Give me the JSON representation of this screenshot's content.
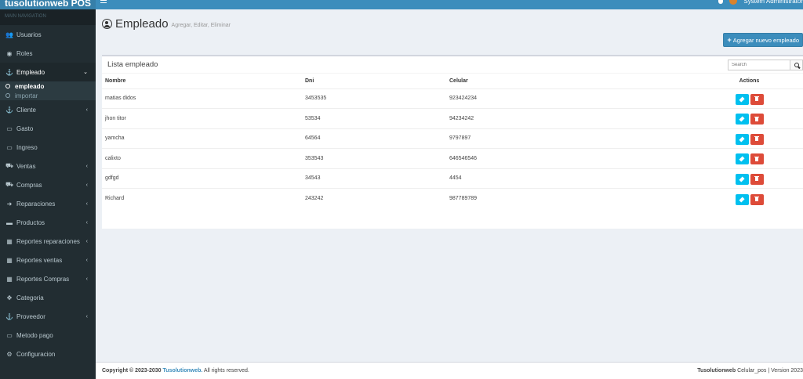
{
  "app": {
    "brand": "tusolutionweb POS",
    "user_name": "System Administrator"
  },
  "sidebar": {
    "header": "MAIN NAVIGATION",
    "items": [
      {
        "label": "Usuarios",
        "icon": "users-icon",
        "chevron": false
      },
      {
        "label": "Roles",
        "icon": "user-circle-icon",
        "chevron": false
      },
      {
        "label": "Empleado",
        "icon": "anchor-icon",
        "chevron": true,
        "active": true
      },
      {
        "label": "Cliente",
        "icon": "anchor-icon",
        "chevron": true
      },
      {
        "label": "Gasto",
        "icon": "money-icon",
        "chevron": false
      },
      {
        "label": "Ingreso",
        "icon": "money-icon",
        "chevron": false
      },
      {
        "label": "Ventas",
        "icon": "cart-icon",
        "chevron": true
      },
      {
        "label": "Compras",
        "icon": "cart-icon",
        "chevron": true
      },
      {
        "label": "Reparaciones",
        "icon": "sign-in-icon",
        "chevron": true
      },
      {
        "label": "Productos",
        "icon": "product-icon",
        "chevron": true
      },
      {
        "label": "Reportes reparaciones",
        "icon": "calendar-icon",
        "chevron": true
      },
      {
        "label": "Reportes ventas",
        "icon": "calendar-icon",
        "chevron": true
      },
      {
        "label": "Reportes Compras",
        "icon": "calendar-icon",
        "chevron": true
      },
      {
        "label": "Categoria",
        "icon": "arrows-icon",
        "chevron": false
      },
      {
        "label": "Proveedor",
        "icon": "anchor-icon",
        "chevron": true
      },
      {
        "label": "Metodo pago",
        "icon": "money-icon",
        "chevron": false
      },
      {
        "label": "Configuracion",
        "icon": "cogs-icon",
        "chevron": false
      }
    ],
    "submenu": [
      "empleado",
      "importar"
    ]
  },
  "page": {
    "title": "Empleado",
    "subtitle": "Agregar, Editar, Eliminar",
    "add_button": "Agregar nuevo empleado"
  },
  "box": {
    "title": "Lista empleado",
    "search_placeholder": "Search",
    "columns": [
      "Nombre",
      "Dni",
      "Celular",
      "Actions"
    ],
    "rows": [
      {
        "nombre": "matias didos",
        "dni": "3453535",
        "celular": "923424234"
      },
      {
        "nombre": "jhon titor",
        "dni": "53534",
        "celular": "94234242"
      },
      {
        "nombre": "yamcha",
        "dni": "64564",
        "celular": "9797897"
      },
      {
        "nombre": "calixto",
        "dni": "353543",
        "celular": "646546546"
      },
      {
        "nombre": "gdfgd",
        "dni": "34543",
        "celular": "4454"
      },
      {
        "nombre": "Richard",
        "dni": "243242",
        "celular": "987789789"
      }
    ]
  },
  "footer": {
    "copyright": "Copyright © 2023-2030",
    "company": "Tusolutionweb.",
    "rights": "All rights reserved.",
    "product_brand": "Tusolutionweb",
    "product_version": "Celular_pos | Version 2023"
  },
  "colors": {
    "primary": "#3c8dbc",
    "sidebar": "#222d32",
    "edit": "#00c0ef",
    "delete": "#dd4b39"
  }
}
